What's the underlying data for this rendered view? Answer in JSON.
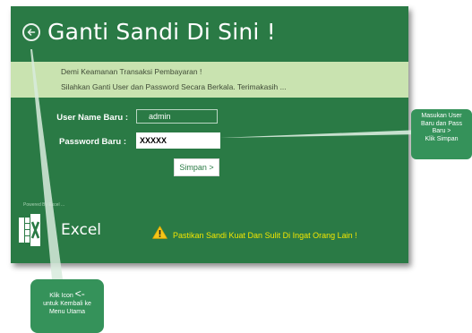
{
  "header": {
    "title": "Ganti Sandi Di Sini !"
  },
  "info_band": {
    "line1": "Demi Keamanan Transaksi Pembayaran !",
    "line2": "Silahkan Ganti User dan Password Secara Berkala. Terimakasih ..."
  },
  "form": {
    "username_label": "User Name Baru :",
    "username_value": "admin",
    "password_label": "Password Baru :",
    "password_value": "XXXXX",
    "submit_label": "Simpan >"
  },
  "branding": {
    "powered_by": "Powered By Excel ...",
    "app_name": "Excel"
  },
  "warning": {
    "icon": "warning-icon",
    "text": "Pastikan Sandi Kuat Dan Sulit Di Ingat Orang Lain !"
  },
  "callouts": {
    "right": {
      "line1": "Masukan User",
      "line2": "Baru dan Pass",
      "line3": "Baru >",
      "line4": "Klik Simpan"
    },
    "bottom": {
      "line1_text": "Klik Icon",
      "line1_symbol": "<-",
      "line2": "untuk Kembali ke",
      "line3": "Menu Utama"
    }
  },
  "colors": {
    "panel": "#2a7a45",
    "band": "#c9e3b0",
    "callout": "#35925a",
    "warning_text": "#f2e600"
  }
}
